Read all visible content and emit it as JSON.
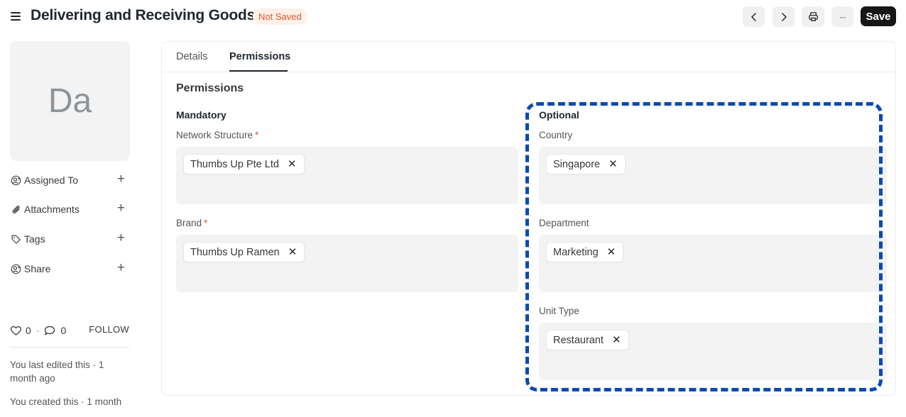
{
  "header": {
    "title": "Delivering and Receiving Goods",
    "status": "Not Saved",
    "prev_icon": "chevron-left-icon",
    "next_icon": "chevron-right-icon",
    "print_icon": "printer-icon",
    "more_label": "···",
    "save_label": "Save"
  },
  "sidebar": {
    "avatar_initials": "Da",
    "items": [
      {
        "label": "Assigned To",
        "icon": "assign-user-icon"
      },
      {
        "label": "Attachments",
        "icon": "paperclip-icon"
      },
      {
        "label": "Tags",
        "icon": "tag-icon"
      },
      {
        "label": "Share",
        "icon": "share-user-icon"
      }
    ],
    "likes": "0",
    "separator": "·",
    "comments": "0",
    "follow_label": "FOLLOW",
    "last_edited": "You last edited this · 1 month ago",
    "created": "You created this · 1 month"
  },
  "tabs": [
    {
      "label": "Details"
    },
    {
      "label": "Permissions"
    }
  ],
  "permissions": {
    "section_title": "Permissions",
    "mandatory": {
      "heading": "Mandatory",
      "fields": [
        {
          "label": "Network Structure",
          "required": "*",
          "chips": [
            "Thumbs Up Pte Ltd"
          ]
        },
        {
          "label": "Brand",
          "required": "*",
          "chips": [
            "Thumbs Up Ramen"
          ]
        }
      ]
    },
    "optional": {
      "heading": "Optional",
      "fields": [
        {
          "label": "Country",
          "chips": [
            "Singapore"
          ]
        },
        {
          "label": "Department",
          "chips": [
            "Marketing"
          ]
        },
        {
          "label": "Unit Type",
          "chips": [
            "Restaurant"
          ]
        }
      ]
    },
    "remove_glyph": "✕"
  },
  "colors": {
    "highlight": "#0a4ab4",
    "status_text": "#e0562a",
    "status_bg": "#fff0e8",
    "save_bg": "#171717"
  }
}
